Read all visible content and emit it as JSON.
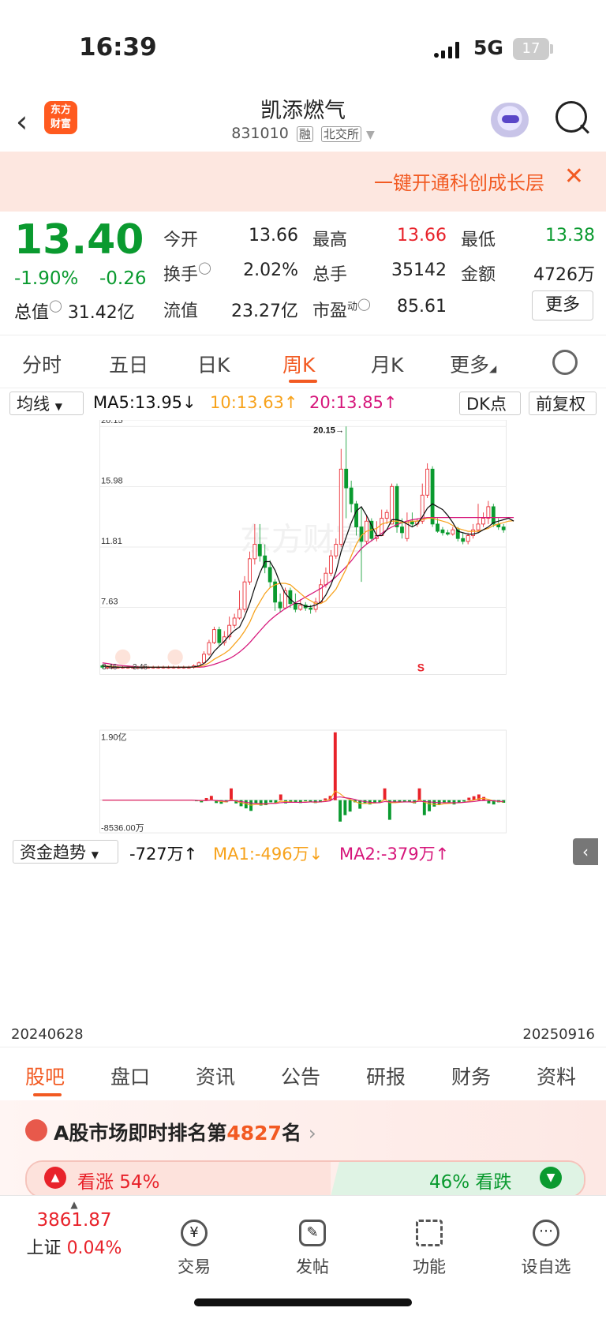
{
  "status": {
    "time": "16:39",
    "network": "5G",
    "battery": "17"
  },
  "header": {
    "logo_line1": "东方",
    "logo_line2": "财富",
    "name": "凯添燃气",
    "code": "831010",
    "tag1": "融",
    "tag2": "北交所"
  },
  "banner": {
    "text": "一键开通科创成长层",
    "close": "✕"
  },
  "quote": {
    "price": "13.40",
    "change_pct": "-1.90%",
    "change": "-0.26",
    "open_label": "今开",
    "open": "13.66",
    "high_label": "最高",
    "high": "13.66",
    "low_label": "最低",
    "low": "13.38",
    "turnover_label": "换手",
    "turnover": "2.02%",
    "volume_label": "总手",
    "volume": "35142",
    "amount_label": "金额",
    "amount": "4726万",
    "mktcap_label": "总值",
    "mktcap": "31.42亿",
    "float_label": "流值",
    "float": "23.27亿",
    "pe_label": "市盈",
    "pe_sup": "动",
    "pe": "85.61",
    "more": "更多"
  },
  "tabs": [
    "分时",
    "五日",
    "日K",
    "周K",
    "月K",
    "更多"
  ],
  "active_tab": "周K",
  "ma_bar": {
    "selector": "均线",
    "ma5": "MA5:13.95↓",
    "ma10": "10:13.63↑",
    "ma20": "20:13.85↑",
    "dk": "DK点",
    "adjust": "前复权"
  },
  "colors": {
    "up": "#e8222a",
    "down": "#0a9a2f",
    "ma5": "#111111",
    "ma10": "#f7a21b",
    "ma20": "#d6157a",
    "accent": "#f25a22"
  },
  "chart_data": [
    {
      "type": "candlestick",
      "y_ticks": [
        "20.15",
        "15.98",
        "11.81",
        "7.63"
      ],
      "left_labels": [
        "3.46",
        "3.46"
      ],
      "max_label": "20.15→",
      "signal_label": "S",
      "watermark": "东方财富",
      "ylim": [
        3.0,
        20.6
      ],
      "candles": [
        {
          "o": 3.6,
          "c": 3.5,
          "h": 3.7,
          "l": 3.4
        },
        {
          "o": 3.5,
          "c": 3.5,
          "h": 3.6,
          "l": 3.4
        },
        {
          "o": 3.5,
          "c": 3.5,
          "h": 3.6,
          "l": 3.4
        },
        {
          "o": 3.5,
          "c": 3.5,
          "h": 3.6,
          "l": 3.4
        },
        {
          "o": 3.5,
          "c": 3.5,
          "h": 3.6,
          "l": 3.4
        },
        {
          "o": 3.5,
          "c": 3.5,
          "h": 3.6,
          "l": 3.4
        },
        {
          "o": 3.5,
          "c": 3.5,
          "h": 3.6,
          "l": 3.4
        },
        {
          "o": 3.5,
          "c": 3.5,
          "h": 3.6,
          "l": 3.4
        },
        {
          "o": 3.5,
          "c": 3.5,
          "h": 3.6,
          "l": 3.4
        },
        {
          "o": 3.5,
          "c": 3.5,
          "h": 3.6,
          "l": 3.4
        },
        {
          "o": 3.5,
          "c": 3.5,
          "h": 3.6,
          "l": 3.4
        },
        {
          "o": 3.5,
          "c": 3.5,
          "h": 3.6,
          "l": 3.4
        },
        {
          "o": 3.5,
          "c": 3.5,
          "h": 3.6,
          "l": 3.4
        },
        {
          "o": 3.5,
          "c": 3.5,
          "h": 3.6,
          "l": 3.4
        },
        {
          "o": 3.5,
          "c": 3.5,
          "h": 3.6,
          "l": 3.4
        },
        {
          "o": 3.5,
          "c": 3.5,
          "h": 3.6,
          "l": 3.4
        },
        {
          "o": 3.5,
          "c": 3.5,
          "h": 3.6,
          "l": 3.4
        },
        {
          "o": 3.5,
          "c": 3.5,
          "h": 3.6,
          "l": 3.4
        },
        {
          "o": 3.5,
          "c": 3.6,
          "h": 3.7,
          "l": 3.4
        },
        {
          "o": 3.6,
          "c": 3.8,
          "h": 3.9,
          "l": 3.5
        },
        {
          "o": 3.8,
          "c": 4.4,
          "h": 4.6,
          "l": 3.7
        },
        {
          "o": 4.4,
          "c": 5.2,
          "h": 5.4,
          "l": 4.3
        },
        {
          "o": 5.2,
          "c": 6.1,
          "h": 6.3,
          "l": 5.1
        },
        {
          "o": 6.1,
          "c": 5.2,
          "h": 6.3,
          "l": 5.0
        },
        {
          "o": 5.2,
          "c": 5.6,
          "h": 6.0,
          "l": 5.0
        },
        {
          "o": 5.6,
          "c": 6.4,
          "h": 7.0,
          "l": 5.4
        },
        {
          "o": 6.4,
          "c": 6.9,
          "h": 7.2,
          "l": 6.2
        },
        {
          "o": 6.9,
          "c": 7.5,
          "h": 8.8,
          "l": 6.8
        },
        {
          "o": 7.5,
          "c": 9.4,
          "h": 9.8,
          "l": 7.3
        },
        {
          "o": 9.4,
          "c": 11.0,
          "h": 11.5,
          "l": 9.2
        },
        {
          "o": 11.0,
          "c": 12.0,
          "h": 13.4,
          "l": 10.6
        },
        {
          "o": 12.0,
          "c": 11.2,
          "h": 13.4,
          "l": 10.8
        },
        {
          "o": 11.2,
          "c": 10.4,
          "h": 12.0,
          "l": 10.0
        },
        {
          "o": 10.4,
          "c": 9.4,
          "h": 10.9,
          "l": 9.0
        },
        {
          "o": 9.4,
          "c": 8.0,
          "h": 9.6,
          "l": 7.4
        },
        {
          "o": 8.0,
          "c": 7.6,
          "h": 8.6,
          "l": 7.3
        },
        {
          "o": 7.6,
          "c": 8.8,
          "h": 9.0,
          "l": 7.5
        },
        {
          "o": 8.8,
          "c": 7.9,
          "h": 9.0,
          "l": 7.6
        },
        {
          "o": 7.9,
          "c": 7.5,
          "h": 8.6,
          "l": 7.3
        },
        {
          "o": 7.5,
          "c": 7.8,
          "h": 8.2,
          "l": 7.4
        },
        {
          "o": 7.8,
          "c": 7.6,
          "h": 8.0,
          "l": 7.4
        },
        {
          "o": 7.6,
          "c": 7.5,
          "h": 7.8,
          "l": 7.2
        },
        {
          "o": 7.5,
          "c": 8.0,
          "h": 8.3,
          "l": 7.3
        },
        {
          "o": 8.0,
          "c": 9.2,
          "h": 9.6,
          "l": 7.9
        },
        {
          "o": 9.2,
          "c": 10.0,
          "h": 10.4,
          "l": 9.0
        },
        {
          "o": 10.0,
          "c": 11.2,
          "h": 11.6,
          "l": 9.8
        },
        {
          "o": 11.2,
          "c": 12.0,
          "h": 12.4,
          "l": 11.0
        },
        {
          "o": 12.0,
          "c": 17.2,
          "h": 18.6,
          "l": 11.8
        },
        {
          "o": 17.2,
          "c": 15.9,
          "h": 20.15,
          "l": 13.8
        },
        {
          "o": 15.9,
          "c": 14.8,
          "h": 16.4,
          "l": 14.2
        },
        {
          "o": 14.8,
          "c": 13.2,
          "h": 15.0,
          "l": 12.6
        },
        {
          "o": 13.2,
          "c": 12.2,
          "h": 14.6,
          "l": 9.4
        },
        {
          "o": 12.2,
          "c": 13.6,
          "h": 14.0,
          "l": 12.0
        },
        {
          "o": 13.6,
          "c": 12.4,
          "h": 13.8,
          "l": 12.2
        },
        {
          "o": 12.4,
          "c": 12.6,
          "h": 13.6,
          "l": 12.2
        },
        {
          "o": 12.6,
          "c": 13.8,
          "h": 14.4,
          "l": 12.6
        },
        {
          "o": 13.8,
          "c": 14.2,
          "h": 14.4,
          "l": 13.4
        },
        {
          "o": 13.4,
          "c": 16.0,
          "h": 16.2,
          "l": 13.4
        },
        {
          "o": 16.0,
          "c": 13.2,
          "h": 16.2,
          "l": 12.8
        },
        {
          "o": 13.2,
          "c": 12.8,
          "h": 13.8,
          "l": 12.4
        },
        {
          "o": 12.4,
          "c": 13.6,
          "h": 14.2,
          "l": 12.2
        },
        {
          "o": 13.6,
          "c": 13.4,
          "h": 14.2,
          "l": 13.2
        },
        {
          "o": 13.4,
          "c": 13.6,
          "h": 13.8,
          "l": 13.2
        },
        {
          "o": 13.6,
          "c": 15.4,
          "h": 16.2,
          "l": 13.4
        },
        {
          "o": 15.4,
          "c": 17.2,
          "h": 17.6,
          "l": 15.2
        },
        {
          "o": 17.2,
          "c": 13.4,
          "h": 17.4,
          "l": 13.2
        },
        {
          "o": 13.4,
          "c": 12.9,
          "h": 13.8,
          "l": 12.8
        },
        {
          "o": 13.0,
          "c": 12.8,
          "h": 13.2,
          "l": 12.6
        },
        {
          "o": 12.8,
          "c": 12.7,
          "h": 13.0,
          "l": 12.6
        },
        {
          "o": 12.7,
          "c": 13.0,
          "h": 13.2,
          "l": 12.6
        },
        {
          "o": 13.0,
          "c": 12.4,
          "h": 13.2,
          "l": 12.2
        },
        {
          "o": 12.4,
          "c": 12.2,
          "h": 12.8,
          "l": 12.0
        },
        {
          "o": 12.2,
          "c": 12.6,
          "h": 12.8,
          "l": 12.0
        },
        {
          "o": 12.6,
          "c": 13.0,
          "h": 13.4,
          "l": 12.4
        },
        {
          "o": 13.0,
          "c": 13.4,
          "h": 14.8,
          "l": 12.8
        },
        {
          "o": 13.4,
          "c": 13.8,
          "h": 14.2,
          "l": 13.2
        },
        {
          "o": 13.8,
          "c": 14.6,
          "h": 15.0,
          "l": 13.4
        },
        {
          "o": 14.6,
          "c": 13.4,
          "h": 14.8,
          "l": 13.2
        },
        {
          "o": 13.4,
          "c": 13.2,
          "h": 13.8,
          "l": 13.0
        },
        {
          "o": 13.2,
          "c": 13.0,
          "h": 13.4,
          "l": 12.8
        }
      ],
      "ma5": [
        3.6,
        3.55,
        3.5,
        3.5,
        3.5,
        3.5,
        3.5,
        3.5,
        3.5,
        3.5,
        3.5,
        3.5,
        3.5,
        3.5,
        3.5,
        3.5,
        3.5,
        3.5,
        3.52,
        3.58,
        3.76,
        4.1,
        4.6,
        4.95,
        5.3,
        5.7,
        6.04,
        6.28,
        7.0,
        7.9,
        9.0,
        10.0,
        10.8,
        10.8,
        10.2,
        9.3,
        8.6,
        8.2,
        7.9,
        7.9,
        7.7,
        7.7,
        7.8,
        8.0,
        8.5,
        9.2,
        10.1,
        11.5,
        12.5,
        13.5,
        14.3,
        14.6,
        14.0,
        13.3,
        12.6,
        12.6,
        13.0,
        13.7,
        13.7,
        13.6,
        13.4,
        13.2,
        13.4,
        13.9,
        14.5,
        14.8,
        14.6,
        14.4,
        14.0,
        13.5,
        12.9,
        12.8,
        12.7,
        12.7,
        12.8,
        13.0,
        13.2,
        13.5,
        13.6,
        13.7,
        13.8,
        13.6
      ],
      "ma10": [
        3.6,
        3.58,
        3.55,
        3.52,
        3.5,
        3.5,
        3.5,
        3.5,
        3.5,
        3.5,
        3.5,
        3.5,
        3.5,
        3.5,
        3.5,
        3.5,
        3.5,
        3.5,
        3.51,
        3.54,
        3.62,
        3.8,
        4.05,
        4.25,
        4.45,
        4.7,
        5.1,
        5.5,
        6.0,
        6.6,
        7.4,
        8.0,
        8.6,
        9.0,
        9.2,
        9.3,
        9.3,
        9.2,
        8.9,
        8.6,
        8.3,
        8.1,
        7.9,
        7.9,
        8.1,
        8.5,
        8.9,
        9.6,
        10.3,
        11.2,
        12.0,
        12.6,
        12.9,
        13.0,
        13.1,
        13.4,
        13.5,
        13.6,
        13.6,
        13.5,
        13.5,
        13.6,
        13.6,
        13.7,
        13.8,
        13.8,
        13.7,
        13.6,
        13.5,
        13.3,
        13.1,
        13.0,
        12.9,
        12.9,
        12.9,
        13.0,
        13.1,
        13.3,
        13.4,
        13.5,
        13.6,
        13.63
      ],
      "ma20": [
        3.8,
        3.75,
        3.7,
        3.65,
        3.6,
        3.58,
        3.55,
        3.52,
        3.5,
        3.5,
        3.5,
        3.5,
        3.5,
        3.5,
        3.5,
        3.5,
        3.5,
        3.5,
        3.5,
        3.5,
        3.52,
        3.6,
        3.7,
        3.82,
        3.95,
        4.1,
        4.3,
        4.55,
        4.85,
        5.2,
        5.6,
        6.0,
        6.4,
        6.75,
        7.05,
        7.3,
        7.55,
        7.75,
        7.95,
        8.15,
        8.35,
        8.55,
        8.75,
        8.95,
        9.2,
        9.45,
        9.75,
        10.1,
        10.45,
        10.85,
        11.3,
        11.7,
        12.0,
        12.25,
        12.5,
        12.75,
        13.0,
        13.2,
        13.35,
        13.5,
        13.6,
        13.7,
        13.75,
        13.8,
        13.85,
        13.85,
        13.85,
        13.85,
        13.85,
        13.85,
        13.85,
        13.85,
        13.85,
        13.85,
        13.85,
        13.85,
        13.85,
        13.85,
        13.85,
        13.85,
        13.85,
        13.85
      ]
    },
    {
      "type": "bar",
      "title": "资金趋势",
      "value_label": "-727万↑",
      "ma1_label": "MA1:-496万↓",
      "ma2_label": "MA2:-379万↑",
      "y_top_label": "1.90亿",
      "y_bottom_label": "-8536.00万",
      "x_start": "20240628",
      "x_end": "20250916",
      "ylim": [
        -8536,
        19000
      ],
      "values": [
        0,
        0,
        0,
        0,
        0,
        0,
        0,
        0,
        0,
        0,
        0,
        0,
        0,
        0,
        0,
        0,
        0,
        0,
        0,
        -300,
        -600,
        600,
        1200,
        -800,
        -1000,
        -600,
        3300,
        -900,
        -1700,
        -2300,
        -3000,
        -800,
        -1500,
        -1400,
        -600,
        -900,
        1600,
        -900,
        -400,
        -600,
        -800,
        -300,
        -500,
        -800,
        -600,
        500,
        1200,
        19000,
        -6000,
        -4200,
        -3200,
        -600,
        -2400,
        -1000,
        -1200,
        -800,
        -600,
        3300,
        -5500,
        -800,
        -500,
        -600,
        -400,
        -900,
        3300,
        -4200,
        -3100,
        -1800,
        -1200,
        -600,
        -600,
        -1200,
        -800,
        -400,
        700,
        1100,
        1600,
        900,
        -900,
        -1200,
        -600,
        -727
      ],
      "ma1": [
        0,
        0,
        0,
        0,
        0,
        0,
        0,
        0,
        0,
        0,
        0,
        0,
        0,
        0,
        0,
        0,
        0,
        0,
        0,
        -80,
        -200,
        -100,
        100,
        -200,
        -400,
        -500,
        200,
        -300,
        -700,
        -1000,
        -1400,
        -1200,
        -1200,
        -1100,
        -900,
        -800,
        -300,
        -400,
        -500,
        -600,
        -600,
        -500,
        -500,
        -600,
        -500,
        -200,
        300,
        2600,
        1800,
        700,
        200,
        -400,
        -900,
        -900,
        -900,
        -800,
        -700,
        200,
        -700,
        -700,
        -600,
        -500,
        -500,
        -700,
        100,
        -600,
        -1000,
        -1200,
        -1300,
        -1000,
        -900,
        -800,
        -700,
        -600,
        -300,
        0,
        400,
        500,
        200,
        -200,
        -400,
        -496
      ],
      "ma2": [
        0,
        0,
        0,
        0,
        0,
        0,
        0,
        0,
        0,
        0,
        0,
        0,
        0,
        0,
        0,
        0,
        0,
        0,
        0,
        -40,
        -100,
        -100,
        0,
        -100,
        -200,
        -300,
        -100,
        -200,
        -400,
        -600,
        -800,
        -900,
        -1000,
        -1000,
        -900,
        -900,
        -700,
        -600,
        -600,
        -600,
        -600,
        -600,
        -500,
        -500,
        -500,
        -400,
        -200,
        800,
        900,
        700,
        500,
        200,
        -200,
        -400,
        -600,
        -700,
        -700,
        -400,
        -500,
        -500,
        -500,
        -500,
        -500,
        -500,
        -300,
        -400,
        -500,
        -600,
        -700,
        -700,
        -700,
        -700,
        -700,
        -600,
        -500,
        -400,
        -200,
        -100,
        -100,
        -200,
        -300,
        -379
      ]
    }
  ],
  "bottom_tabs": [
    "股吧",
    "盘口",
    "资讯",
    "公告",
    "研报",
    "财务",
    "资料"
  ],
  "active_bottom_tab": "股吧",
  "rank": {
    "prefix": "A股市场即时排名第",
    "number": "4827",
    "suffix": "名",
    "arrow": "›",
    "up_text": "看涨 54%",
    "down_text": "46% 看跌"
  },
  "nav": {
    "index_value": "3861.87",
    "index_name": "上证",
    "index_pct": "0.04%",
    "items": [
      "交易",
      "发帖",
      "功能",
      "设自选"
    ]
  }
}
